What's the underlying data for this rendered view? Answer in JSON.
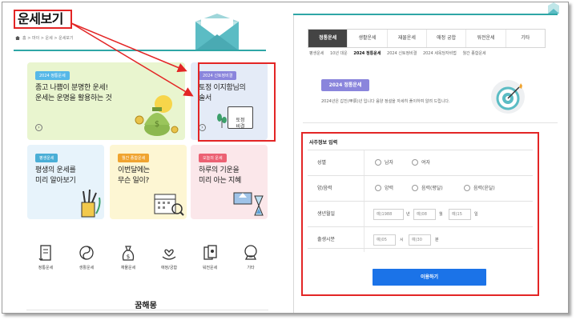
{
  "left": {
    "title": "운세보기",
    "breadcrumb": "홈 > 마이 > 운세 > 운세보기",
    "cards": {
      "main": {
        "badge": "2024 정통운세",
        "text": "종고 나쁨이 분명한 운세!\n운세는 운명을 활용하는 것",
        "badge_color": "#56b8e8"
      },
      "tojeong": {
        "badge": "2024 신토정비결",
        "text": "토정 이지함님의\n술서",
        "badge_color": "#8a85dc",
        "book_label": "토정\n비결"
      },
      "life": {
        "badge": "평생운세",
        "text": "평생의 운세를\n미리 알아보기",
        "badge_color": "#4aaed6"
      },
      "month": {
        "badge": "월간 종합운세",
        "text": "이번달에는\n무슨 일이?",
        "badge_color": "#f0a430"
      },
      "today": {
        "badge": "오늘의 운세",
        "text": "하루의 기운을\n미리 아는 지혜",
        "badge_color": "#ec6173"
      }
    },
    "quick_menu": [
      {
        "label": "정통운세",
        "icon": "scroll-icon"
      },
      {
        "label": "생활운세",
        "icon": "yinyang-icon"
      },
      {
        "label": "재물운세",
        "icon": "money-bag-icon"
      },
      {
        "label": "애정/궁합",
        "icon": "heart-hand-icon"
      },
      {
        "label": "워전운세",
        "icon": "cards-icon"
      },
      {
        "label": "기타",
        "icon": "crystal-ball-icon"
      }
    ],
    "section_title": "꿈해몽"
  },
  "right": {
    "tabs": [
      "정통운세",
      "생활운세",
      "재물운세",
      "애정 궁합",
      "워전운세",
      "기타"
    ],
    "active_tab": 0,
    "subtabs": [
      "평생운세",
      "10년 대운",
      "2024 정통운세",
      "2024 신토정비결",
      "2024 세옥당자비법",
      "월간 종합운세"
    ],
    "active_subtab": 2,
    "year_badge": "2024 정통운세",
    "year_desc": "2024년은 갑진(甲辰)년 입니다 음양 정설을 자세히 풀이하여 알려 드립니다.",
    "form": {
      "title": "사주정보 입력",
      "gender_label": "성별",
      "gender_options": [
        "남자",
        "여자"
      ],
      "calendar_label": "양/음력",
      "calendar_options": [
        "양력",
        "음력(평달)",
        "음력(윤달)"
      ],
      "birthdate_label": "생년월일",
      "year_placeholder": "예)1988",
      "year_unit": "년",
      "month_placeholder": "예)08",
      "month_unit": "월",
      "day_placeholder": "예)15",
      "day_unit": "일",
      "birthtime_label": "출생시분",
      "hour_placeholder": "예)05",
      "hour_unit": "시",
      "minute_placeholder": "예)30",
      "minute_unit": "분",
      "submit_label": "이용하기"
    }
  },
  "colors": {
    "accent_teal": "#2fa6a6",
    "highlight_red": "#e32525",
    "submit_blue": "#1b73e8"
  }
}
